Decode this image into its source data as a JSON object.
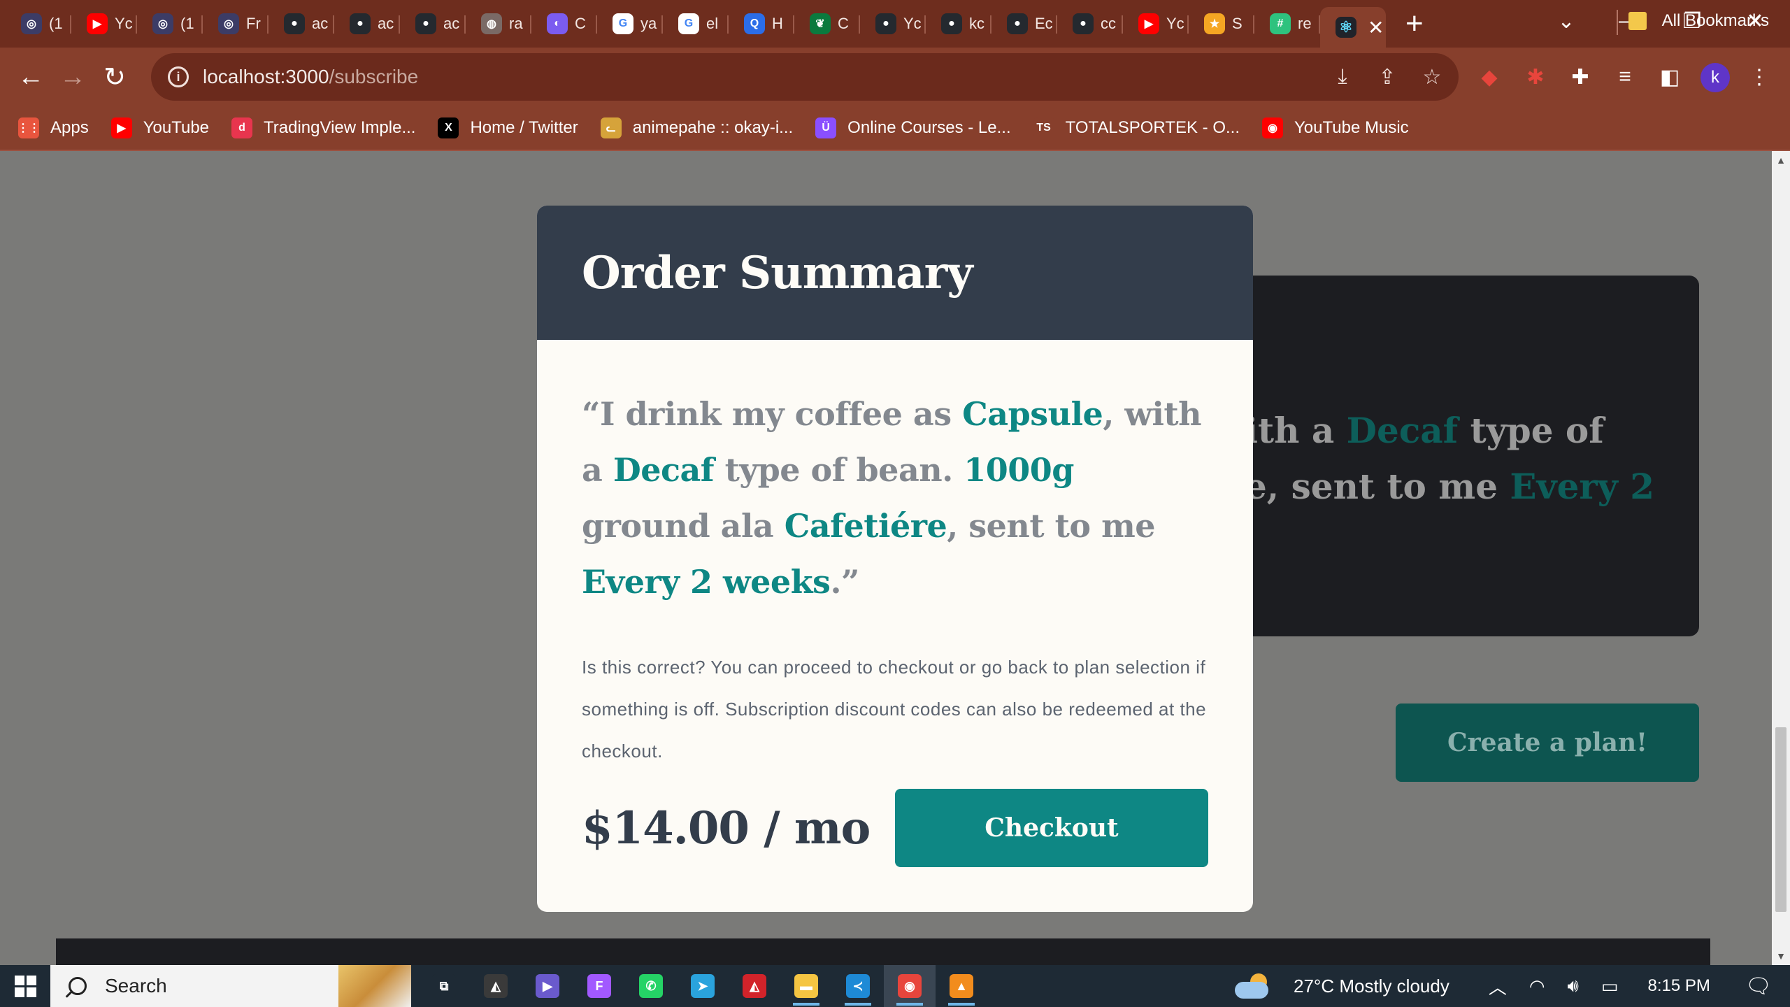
{
  "browser": {
    "tabs": [
      {
        "label": "(1",
        "icon": "search-doc-icon",
        "color": "#3c3c66"
      },
      {
        "label": "Yc",
        "icon": "youtube-icon",
        "color": "#ff0000"
      },
      {
        "label": "(1",
        "icon": "search-doc-icon",
        "color": "#3c3c66"
      },
      {
        "label": "Fr",
        "icon": "search-doc-icon",
        "color": "#3c3c66"
      },
      {
        "label": "ac",
        "icon": "github-icon",
        "color": "#24292f"
      },
      {
        "label": "ac",
        "icon": "github-icon",
        "color": "#24292f"
      },
      {
        "label": "ac",
        "icon": "github-icon",
        "color": "#24292f"
      },
      {
        "label": "ra",
        "icon": "globe-icon",
        "color": "#7a6a66"
      },
      {
        "label": "C",
        "icon": "app-icon",
        "color": "#7b5cf0"
      },
      {
        "label": "ya",
        "icon": "google-icon",
        "color": "#ffffff"
      },
      {
        "label": "el",
        "icon": "google-icon",
        "color": "#ffffff"
      },
      {
        "label": "H",
        "icon": "q-icon",
        "color": "#2b6de8"
      },
      {
        "label": "C",
        "icon": "leaf-icon",
        "color": "#0a7a3e"
      },
      {
        "label": "Yc",
        "icon": "github-icon",
        "color": "#24292f"
      },
      {
        "label": "kc",
        "icon": "github-icon",
        "color": "#24292f"
      },
      {
        "label": "Ec",
        "icon": "github-icon",
        "color": "#24292f"
      },
      {
        "label": "cc",
        "icon": "github-icon",
        "color": "#24292f"
      },
      {
        "label": "Yc",
        "icon": "youtube-music-icon",
        "color": "#ff0000"
      },
      {
        "label": "S",
        "icon": "star-icon",
        "color": "#f5a623"
      },
      {
        "label": "re",
        "icon": "grid-icon",
        "color": "#2ec27e"
      }
    ],
    "active_tab": {
      "label": "",
      "icon": "react-icon"
    },
    "new_tab_label": "+",
    "url_host": "localhost:3000",
    "url_path": "/subscribe",
    "bookmarks": [
      {
        "label": "Apps",
        "icon": "apps-grid-icon",
        "color": "#e8553e"
      },
      {
        "label": "YouTube",
        "icon": "youtube-icon",
        "color": "#ff0000"
      },
      {
        "label": "TradingView Imple...",
        "icon": "tradingview-icon",
        "color": "#e8354e"
      },
      {
        "label": "Home / Twitter",
        "icon": "x-icon",
        "color": "#000000"
      },
      {
        "label": "animepahe :: okay-i...",
        "icon": "cat-icon",
        "color": "#d6a33a"
      },
      {
        "label": "Online Courses - Le...",
        "icon": "udemy-icon",
        "color": "#8a4fff"
      },
      {
        "label": "TOTALSPORTEK - O...",
        "icon": "ts-icon",
        "color": "#873f2c"
      },
      {
        "label": "YouTube Music",
        "icon": "youtube-music-icon",
        "color": "#ff0000"
      }
    ],
    "all_bookmarks_label": "All Bookmarks",
    "profile_initial": "k"
  },
  "page": {
    "background_text_line1": "ith a ",
    "background_text_line1_hl": "Decaf",
    "background_text_line1_end": " type of",
    "background_text_line2": "e, sent to me ",
    "background_text_line2_hl": "Every 2",
    "create_plan_label": "Create a plan!"
  },
  "modal": {
    "title": "Order Summary",
    "quote": {
      "p1": "“I drink my coffee as ",
      "preference": "Capsule",
      "p2": ", with a ",
      "bean_type": "Decaf",
      "p3": " type of bean. ",
      "quantity": "1000g",
      "p4": " ",
      "grind": "ground ala Cafetiére",
      "p5": ", sent to me ",
      "delivery": "Every 2 weeks",
      "p6": ".”"
    },
    "description": "Is this correct? You can proceed to checkout or go back to plan selection if something is off. Subscription discount codes can also be redeemed at the checkout.",
    "price": "$14.00 / mo",
    "checkout_label": "Checkout"
  },
  "taskbar": {
    "search_placeholder": "Search",
    "apps": [
      {
        "name": "task-view-icon",
        "color": "#1e2a35"
      },
      {
        "name": "app-icon",
        "color": "#3a3a3a"
      },
      {
        "name": "media-player-icon",
        "color": "#6a5acd"
      },
      {
        "name": "figma-icon",
        "color": "#a259ff"
      },
      {
        "name": "whatsapp-icon",
        "color": "#25d366"
      },
      {
        "name": "telegram-icon",
        "color": "#2aa3dd"
      },
      {
        "name": "app-icon",
        "color": "#d2232a"
      },
      {
        "name": "file-explorer-icon",
        "color": "#f5c542"
      },
      {
        "name": "vscode-icon",
        "color": "#1e8ad6"
      },
      {
        "name": "chrome-icon",
        "color": "#e8453c"
      },
      {
        "name": "vlc-icon",
        "color": "#f28c1d"
      }
    ],
    "weather": "27°C  Mostly cloudy",
    "time": "8:15 PM"
  },
  "colors": {
    "accent": "#0e8784",
    "modal_header": "#333d4b",
    "chrome": "#873f2c"
  }
}
